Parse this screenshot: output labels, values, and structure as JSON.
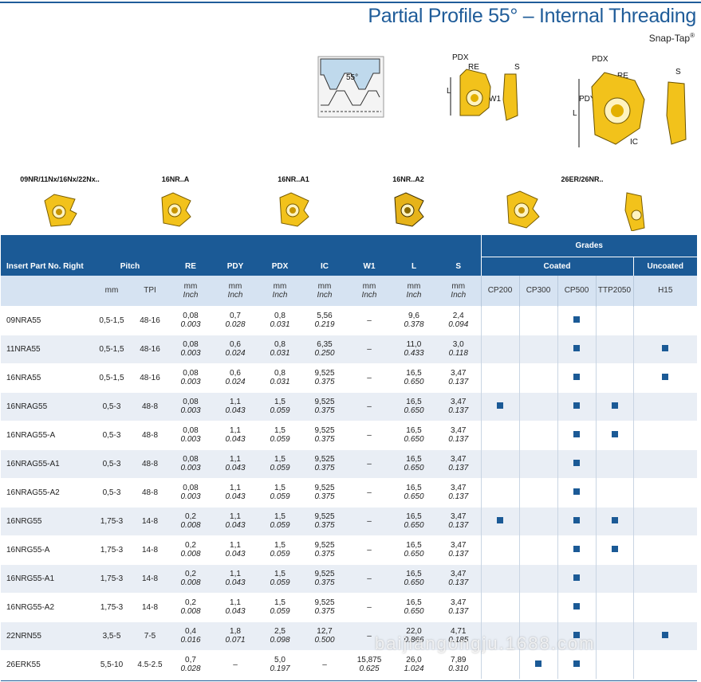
{
  "header": {
    "title": "Partial Profile 55° –  Internal Threading",
    "subtitle": "Snap-Tap",
    "subtitle_mark": "®"
  },
  "drawings": {
    "profile_angle": "55°",
    "labels": {
      "pdx": "PDX",
      "re": "RE",
      "pdy": "PDY",
      "l": "L",
      "w1": "W1",
      "s": "S",
      "ic": "IC"
    }
  },
  "inserts": [
    {
      "name": "09NR/11Nx/16Nx/22Nx.."
    },
    {
      "name": "16NR..A"
    },
    {
      "name": "16NR..A1"
    },
    {
      "name": "16NR..A2"
    },
    {
      "name": "26ER/26NR.."
    }
  ],
  "table": {
    "headers": {
      "part_no": "Insert Part No. Right",
      "pitch": "Pitch",
      "re": "RE",
      "pdy": "PDY",
      "pdx": "PDX",
      "ic": "IC",
      "w1": "W1",
      "l": "L",
      "s": "S",
      "grades": "Grades",
      "coated": "Coated",
      "uncoated": "Uncoated"
    },
    "units": {
      "mm": "mm",
      "tpi": "TPI",
      "mm_inch_1": "mm",
      "mm_inch_2": "Inch"
    },
    "grade_cols": [
      "CP200",
      "CP300",
      "CP500",
      "TTP2050",
      "H15"
    ],
    "grade_color": "#1b5a96",
    "rows": [
      {
        "pn": "09NRA55",
        "mm": "0,5-1,5",
        "tpi": "48-16",
        "re": [
          "0,08",
          "0.003"
        ],
        "pdy": [
          "0,7",
          "0.028"
        ],
        "pdx": [
          "0,8",
          "0.031"
        ],
        "ic": [
          "5,56",
          "0.219"
        ],
        "w1": [
          "–",
          ""
        ],
        "l": [
          "9,6",
          "0.378"
        ],
        "s": [
          "2,4",
          "0.094"
        ],
        "g": [
          0,
          0,
          1,
          0,
          0
        ]
      },
      {
        "pn": "11NRA55",
        "mm": "0,5-1,5",
        "tpi": "48-16",
        "re": [
          "0,08",
          "0.003"
        ],
        "pdy": [
          "0,6",
          "0.024"
        ],
        "pdx": [
          "0,8",
          "0.031"
        ],
        "ic": [
          "6,35",
          "0.250"
        ],
        "w1": [
          "–",
          ""
        ],
        "l": [
          "11,0",
          "0.433"
        ],
        "s": [
          "3,0",
          "0.118"
        ],
        "g": [
          0,
          0,
          1,
          0,
          1
        ]
      },
      {
        "pn": "16NRA55",
        "mm": "0,5-1,5",
        "tpi": "48-16",
        "re": [
          "0,08",
          "0.003"
        ],
        "pdy": [
          "0,6",
          "0.024"
        ],
        "pdx": [
          "0,8",
          "0.031"
        ],
        "ic": [
          "9,525",
          "0.375"
        ],
        "w1": [
          "–",
          ""
        ],
        "l": [
          "16,5",
          "0.650"
        ],
        "s": [
          "3,47",
          "0.137"
        ],
        "g": [
          0,
          0,
          1,
          0,
          1
        ]
      },
      {
        "pn": "16NRAG55",
        "mm": "0,5-3",
        "tpi": "48-8",
        "re": [
          "0,08",
          "0.003"
        ],
        "pdy": [
          "1,1",
          "0.043"
        ],
        "pdx": [
          "1,5",
          "0.059"
        ],
        "ic": [
          "9,525",
          "0.375"
        ],
        "w1": [
          "–",
          ""
        ],
        "l": [
          "16,5",
          "0.650"
        ],
        "s": [
          "3,47",
          "0.137"
        ],
        "g": [
          1,
          0,
          1,
          1,
          0
        ]
      },
      {
        "pn": "16NRAG55-A",
        "mm": "0,5-3",
        "tpi": "48-8",
        "re": [
          "0,08",
          "0.003"
        ],
        "pdy": [
          "1,1",
          "0.043"
        ],
        "pdx": [
          "1,5",
          "0.059"
        ],
        "ic": [
          "9,525",
          "0.375"
        ],
        "w1": [
          "–",
          ""
        ],
        "l": [
          "16,5",
          "0.650"
        ],
        "s": [
          "3,47",
          "0.137"
        ],
        "g": [
          0,
          0,
          1,
          1,
          0
        ]
      },
      {
        "pn": "16NRAG55-A1",
        "mm": "0,5-3",
        "tpi": "48-8",
        "re": [
          "0,08",
          "0.003"
        ],
        "pdy": [
          "1,1",
          "0.043"
        ],
        "pdx": [
          "1,5",
          "0.059"
        ],
        "ic": [
          "9,525",
          "0.375"
        ],
        "w1": [
          "–",
          ""
        ],
        "l": [
          "16,5",
          "0.650"
        ],
        "s": [
          "3,47",
          "0.137"
        ],
        "g": [
          0,
          0,
          1,
          0,
          0
        ]
      },
      {
        "pn": "16NRAG55-A2",
        "mm": "0,5-3",
        "tpi": "48-8",
        "re": [
          "0,08",
          "0.003"
        ],
        "pdy": [
          "1,1",
          "0.043"
        ],
        "pdx": [
          "1,5",
          "0.059"
        ],
        "ic": [
          "9,525",
          "0.375"
        ],
        "w1": [
          "–",
          ""
        ],
        "l": [
          "16,5",
          "0.650"
        ],
        "s": [
          "3,47",
          "0.137"
        ],
        "g": [
          0,
          0,
          1,
          0,
          0
        ]
      },
      {
        "pn": "16NRG55",
        "mm": "1,75-3",
        "tpi": "14-8",
        "re": [
          "0,2",
          "0.008"
        ],
        "pdy": [
          "1,1",
          "0.043"
        ],
        "pdx": [
          "1,5",
          "0.059"
        ],
        "ic": [
          "9,525",
          "0.375"
        ],
        "w1": [
          "–",
          ""
        ],
        "l": [
          "16,5",
          "0.650"
        ],
        "s": [
          "3,47",
          "0.137"
        ],
        "g": [
          1,
          0,
          1,
          1,
          0
        ]
      },
      {
        "pn": "16NRG55-A",
        "mm": "1,75-3",
        "tpi": "14-8",
        "re": [
          "0,2",
          "0.008"
        ],
        "pdy": [
          "1,1",
          "0.043"
        ],
        "pdx": [
          "1,5",
          "0.059"
        ],
        "ic": [
          "9,525",
          "0.375"
        ],
        "w1": [
          "–",
          ""
        ],
        "l": [
          "16,5",
          "0.650"
        ],
        "s": [
          "3,47",
          "0.137"
        ],
        "g": [
          0,
          0,
          1,
          1,
          0
        ]
      },
      {
        "pn": "16NRG55-A1",
        "mm": "1,75-3",
        "tpi": "14-8",
        "re": [
          "0,2",
          "0.008"
        ],
        "pdy": [
          "1,1",
          "0.043"
        ],
        "pdx": [
          "1,5",
          "0.059"
        ],
        "ic": [
          "9,525",
          "0.375"
        ],
        "w1": [
          "–",
          ""
        ],
        "l": [
          "16,5",
          "0.650"
        ],
        "s": [
          "3,47",
          "0.137"
        ],
        "g": [
          0,
          0,
          1,
          0,
          0
        ]
      },
      {
        "pn": "16NRG55-A2",
        "mm": "1,75-3",
        "tpi": "14-8",
        "re": [
          "0,2",
          "0.008"
        ],
        "pdy": [
          "1,1",
          "0.043"
        ],
        "pdx": [
          "1,5",
          "0.059"
        ],
        "ic": [
          "9,525",
          "0.375"
        ],
        "w1": [
          "–",
          ""
        ],
        "l": [
          "16,5",
          "0.650"
        ],
        "s": [
          "3,47",
          "0.137"
        ],
        "g": [
          0,
          0,
          1,
          0,
          0
        ]
      },
      {
        "pn": "22NRN55",
        "mm": "3,5-5",
        "tpi": "7-5",
        "re": [
          "0,4",
          "0.016"
        ],
        "pdy": [
          "1,8",
          "0.071"
        ],
        "pdx": [
          "2,5",
          "0.098"
        ],
        "ic": [
          "12,7",
          "0.500"
        ],
        "w1": [
          "–",
          ""
        ],
        "l": [
          "22,0",
          "0.866"
        ],
        "s": [
          "4,71",
          "0.185"
        ],
        "g": [
          0,
          0,
          1,
          0,
          1
        ]
      },
      {
        "pn": "26ERK55",
        "mm": "5,5-10",
        "tpi": "4.5-2.5",
        "re": [
          "0,7",
          "0.028"
        ],
        "pdy": [
          "–",
          ""
        ],
        "pdx": [
          "5,0",
          "0.197"
        ],
        "ic": [
          "–",
          ""
        ],
        "w1": [
          "15,875",
          "0.625"
        ],
        "l": [
          "26,0",
          "1.024"
        ],
        "s": [
          "7,89",
          "0.310"
        ],
        "g": [
          0,
          1,
          1,
          0,
          0
        ]
      }
    ]
  },
  "watermark": "baijiangongju.1688.com"
}
